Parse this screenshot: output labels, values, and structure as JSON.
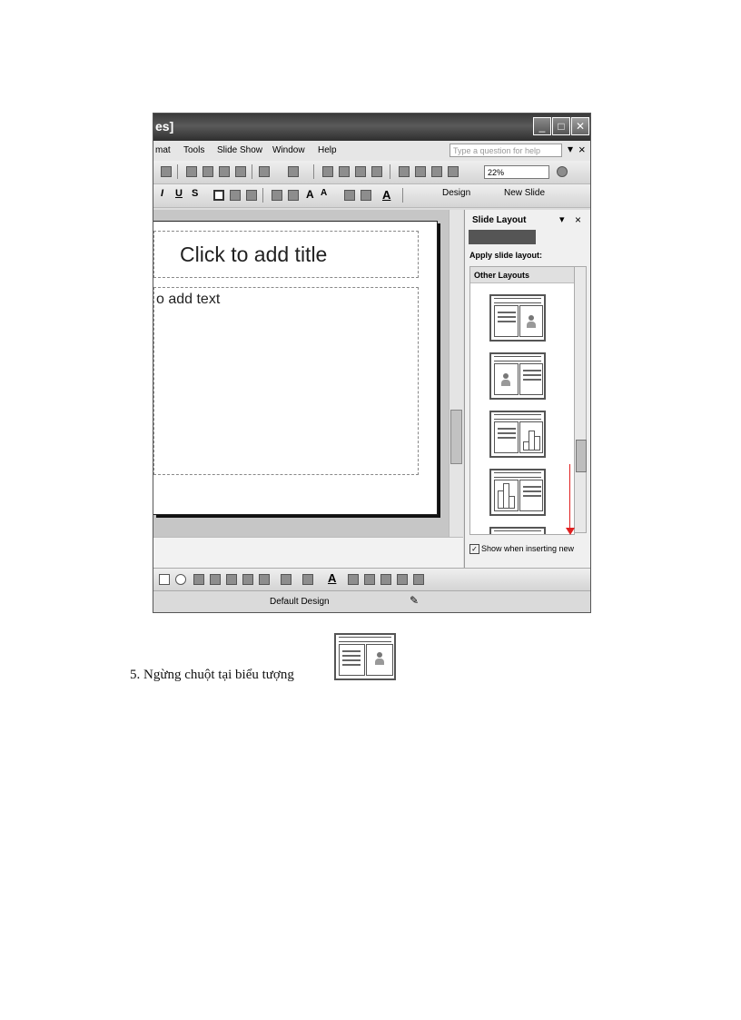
{
  "window": {
    "title": "es]",
    "controls": [
      "_",
      "□",
      "✕"
    ]
  },
  "menubar": {
    "items": [
      "mat",
      "Tools",
      "Slide Show",
      "Window",
      "Help"
    ],
    "help_box": "Type a question for help",
    "close": "×"
  },
  "toolbar_standard": {
    "zoom": "22%"
  },
  "toolbar_format": {
    "italic": "I",
    "underline": "U",
    "shadow": "S",
    "design": "Design",
    "new_slide": "New Slide"
  },
  "slide": {
    "title_placeholder": "Click to add title",
    "body_placeholder": "o add text"
  },
  "task_pane": {
    "title": "Slide Layout",
    "apply_label": "Apply slide layout:",
    "section": "Other Layouts",
    "checkbox_label": "Show when inserting new",
    "checkbox_checked": true
  },
  "status_bar": {
    "design": "Default Design"
  },
  "caption": {
    "text": "5.   Ngừng chuột tại biểu tượng"
  }
}
